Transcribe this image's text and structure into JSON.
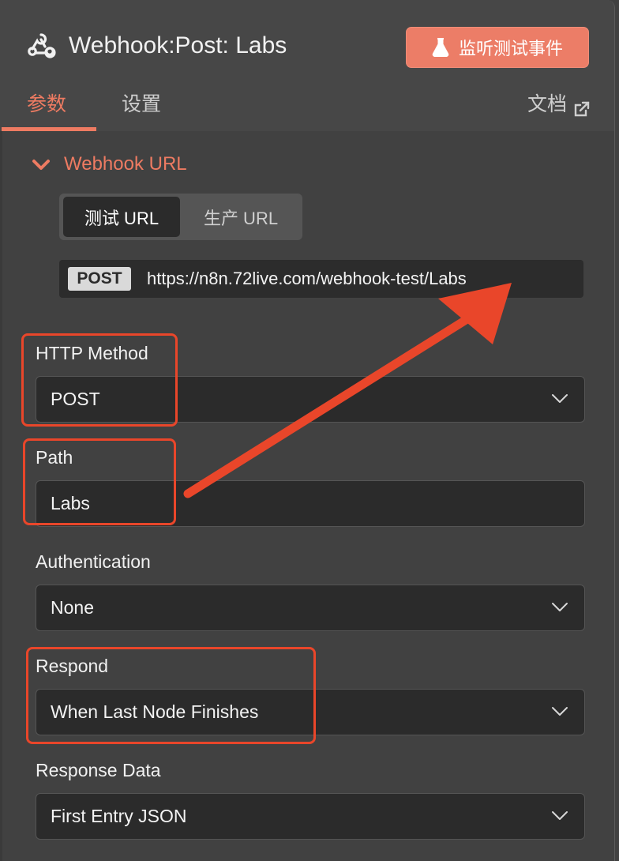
{
  "header": {
    "title": "Webhook:Post: Labs",
    "listen_button": "监听测试事件",
    "tabs": [
      {
        "label": "参数"
      },
      {
        "label": "设置"
      }
    ],
    "docs_label": "文档"
  },
  "section": {
    "title": "Webhook URL",
    "url_tabs": [
      "测试 URL",
      "生产 URL"
    ],
    "method_badge": "POST",
    "url": "https://n8n.72live.com/webhook-test/Labs"
  },
  "fields": {
    "http_method": {
      "label": "HTTP Method",
      "value": "POST"
    },
    "path": {
      "label": "Path",
      "value": "Labs"
    },
    "authentication": {
      "label": "Authentication",
      "value": "None"
    },
    "respond": {
      "label": "Respond",
      "value": "When Last Node Finishes"
    },
    "response_data": {
      "label": "Response Data",
      "value": "First Entry JSON"
    }
  },
  "colors": {
    "accent": "#ee7b62",
    "highlight": "#e9462a",
    "panel": "#414141"
  }
}
